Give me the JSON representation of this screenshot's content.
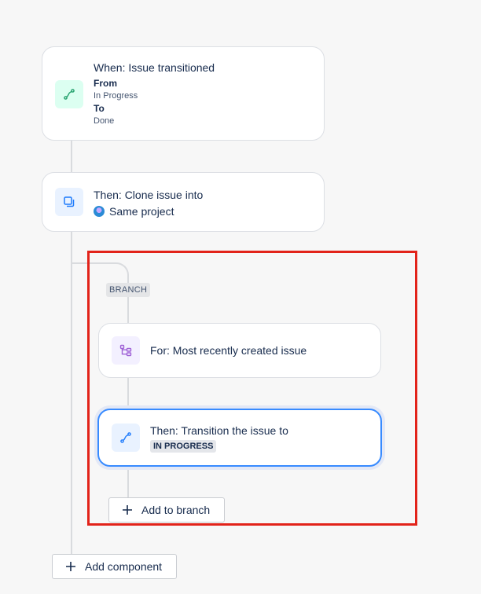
{
  "trigger": {
    "title": "When: Issue transitioned",
    "from_label": "From",
    "from_value": "In Progress",
    "to_label": "To",
    "to_value": "Done",
    "icon": "transition-icon",
    "icon_color": "#22a06b"
  },
  "clone_action": {
    "title": "Then: Clone issue into",
    "project": "Same project",
    "icon": "clone-icon",
    "icon_color": "#1d7afc"
  },
  "branch": {
    "tag": "BRANCH",
    "for_component": {
      "title": "For: Most recently created issue",
      "icon": "branch-hierarchy-icon",
      "icon_color": "#9f61d6"
    },
    "transition_action": {
      "title": "Then: Transition the issue to",
      "status": "IN PROGRESS",
      "icon": "transition-icon",
      "icon_color": "#1d7afc"
    },
    "add_button": "Add to branch"
  },
  "add_component_button": "Add component",
  "colors": {
    "selected_border": "#388bff",
    "highlight": "#e2231a"
  }
}
